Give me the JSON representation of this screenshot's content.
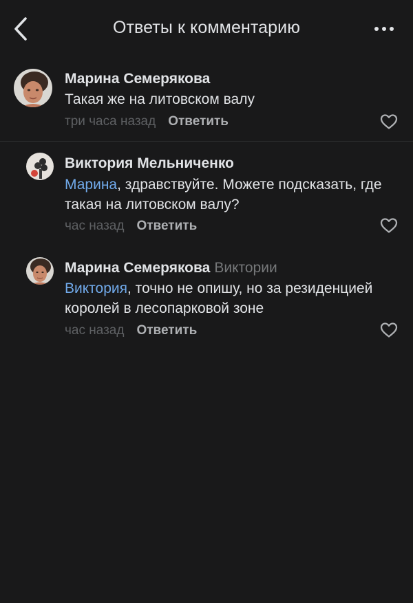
{
  "header": {
    "title": "Ответы к комментарию",
    "back_icon": "chevron-left-icon",
    "more_icon": "more-horizontal-icon"
  },
  "comments": [
    {
      "author": "Марина Семерякова",
      "reply_to": "",
      "mention": "",
      "text": "Такая же на литовском валу",
      "time": "три часа назад",
      "reply_label": "Ответить",
      "like_icon": "heart-icon"
    },
    {
      "author": "Виктория Мельниченко",
      "reply_to": "",
      "mention": "Марина",
      "text": ", здравствуйте. Можете подсказать, где такая на литовском валу?",
      "time": "час назад",
      "reply_label": "Ответить",
      "like_icon": "heart-icon"
    },
    {
      "author": "Марина Семерякова",
      "reply_to": "Виктории",
      "mention": "Виктория",
      "text": ", точно не опишу, но за резиденцией королей в лесопарковой зоне",
      "time": "час назад",
      "reply_label": "Ответить",
      "like_icon": "heart-icon"
    }
  ],
  "colors": {
    "background": "#19191a",
    "text": "#e1e3e6",
    "secondary": "#76787a",
    "link": "#71aaeb"
  }
}
